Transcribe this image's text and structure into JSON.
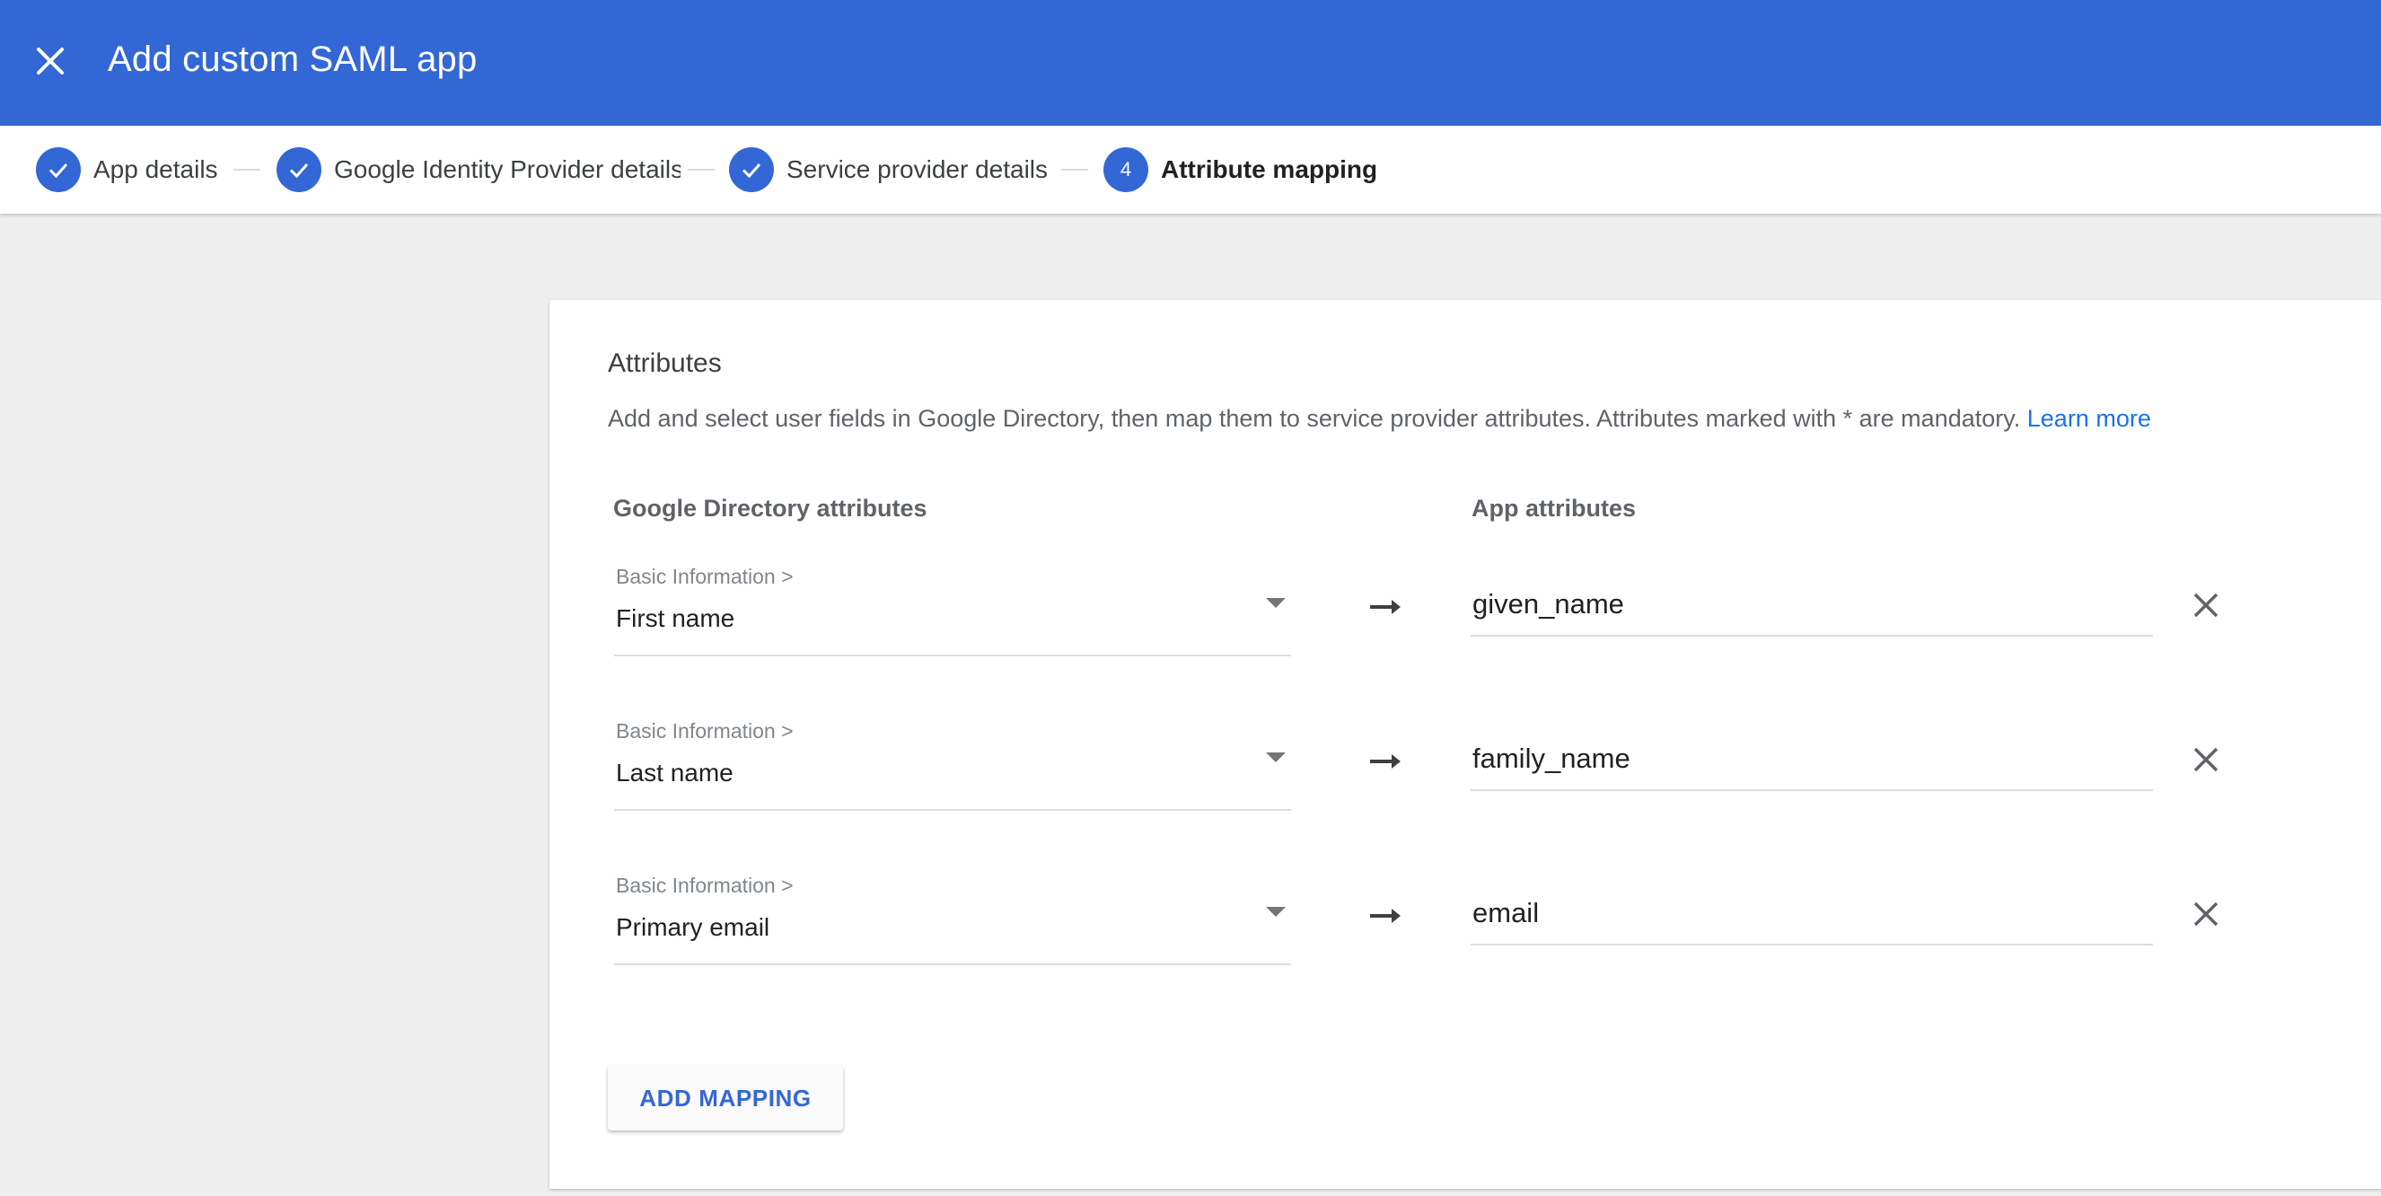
{
  "header": {
    "title": "Add custom SAML app",
    "close_icon": "close-icon"
  },
  "stepper": {
    "steps": [
      {
        "label": "App details",
        "status": "complete",
        "indicator": ""
      },
      {
        "label": "Google Identity Provider details",
        "status": "complete",
        "indicator": ""
      },
      {
        "label": "Service provider details",
        "status": "complete",
        "indicator": ""
      },
      {
        "label": "Attribute mapping",
        "status": "active",
        "indicator": "4"
      }
    ]
  },
  "attributes": {
    "title": "Attributes",
    "description": "Add and select user fields in Google Directory, then map them to service provider attributes. Attributes marked with * are mandatory.",
    "learn_more": "Learn more",
    "directory_header": "Google Directory attributes",
    "app_header": "App attributes",
    "mappings": [
      {
        "category": "Basic Information >",
        "field": "First name",
        "app_attribute": "given_name"
      },
      {
        "category": "Basic Information >",
        "field": "Last name",
        "app_attribute": "family_name"
      },
      {
        "category": "Basic Information >",
        "field": "Primary email",
        "app_attribute": "email"
      }
    ],
    "add_button": "ADD MAPPING"
  },
  "colors": {
    "primary": "#3367d6",
    "link": "#1a73e8",
    "background": "#eeeeee"
  }
}
